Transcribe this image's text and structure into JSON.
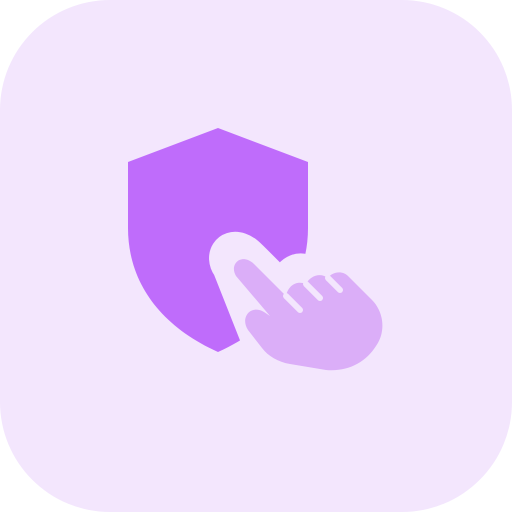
{
  "icon": {
    "semantic_name": "shield-click-icon",
    "components": [
      "shield-icon",
      "pointing-hand-icon"
    ]
  },
  "colors": {
    "background": "#f3e6fd",
    "shield": "#bf6cfb",
    "hand": "#dbaef8",
    "outline": "#f3e6fd"
  }
}
